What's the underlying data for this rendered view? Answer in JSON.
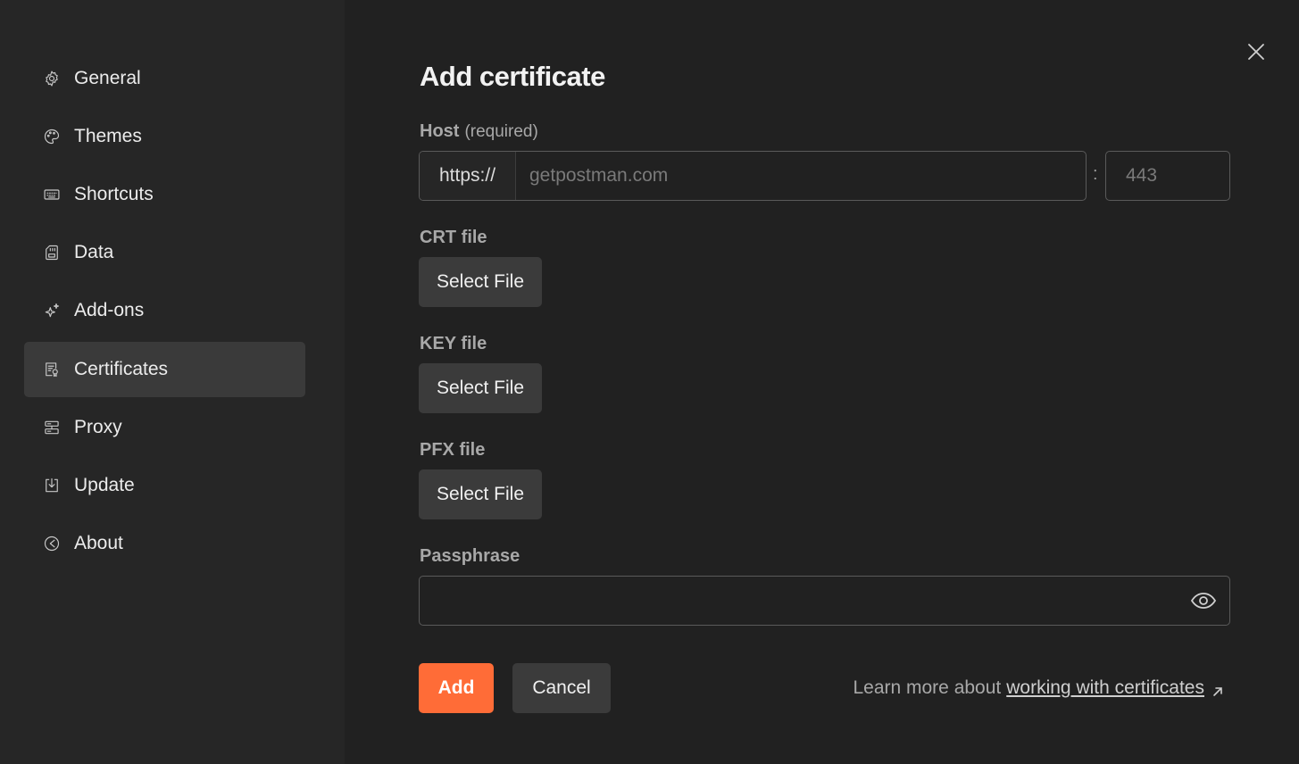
{
  "sidebar": {
    "items": [
      {
        "label": "General",
        "icon": "gear-icon"
      },
      {
        "label": "Themes",
        "icon": "palette-icon"
      },
      {
        "label": "Shortcuts",
        "icon": "keyboard-icon"
      },
      {
        "label": "Data",
        "icon": "sd-card-icon"
      },
      {
        "label": "Add-ons",
        "icon": "sparkle-icon"
      },
      {
        "label": "Certificates",
        "icon": "certificate-icon"
      },
      {
        "label": "Proxy",
        "icon": "server-icon"
      },
      {
        "label": "Update",
        "icon": "download-icon"
      },
      {
        "label": "About",
        "icon": "compass-icon"
      }
    ],
    "active": "Certificates"
  },
  "form": {
    "title": "Add certificate",
    "host_label": "Host",
    "host_hint": "(required)",
    "host_prefix": "https://",
    "host_placeholder": "getpostman.com",
    "port_separator": ":",
    "port_placeholder": "443",
    "crt_label": "CRT file",
    "key_label": "KEY file",
    "pfx_label": "PFX file",
    "select_file_label": "Select File",
    "passphrase_label": "Passphrase",
    "passphrase_value": ""
  },
  "actions": {
    "add_label": "Add",
    "cancel_label": "Cancel",
    "learn_prefix": "Learn more about",
    "learn_link": "working with certificates"
  },
  "colors": {
    "accent": "#ff6c37",
    "background": "#212121",
    "sidebar": "#262626"
  }
}
